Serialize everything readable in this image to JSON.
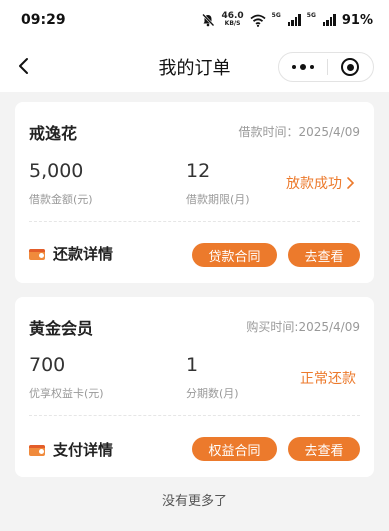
{
  "status_bar": {
    "time": "09:29",
    "net_speed": "46.0",
    "net_unit": "KB/S",
    "sig1_label": "5G",
    "sig2_label": "5G",
    "battery": "91%"
  },
  "nav": {
    "title": "我的订单"
  },
  "orders": [
    {
      "product": "戒逸花",
      "date": "借款时间：2025/4/09",
      "amount": "5,000",
      "amount_label": "借款金额(元)",
      "term": "12",
      "term_label": "借款期限(月)",
      "status": "放款成功",
      "detail": "还款详情",
      "contract_button": "贷款合同",
      "view_button": "去查看"
    },
    {
      "product": "黄金会员",
      "date": "购买时间:2025/4/09",
      "amount": "700",
      "amount_label": "优享权益卡(元)",
      "term": "1",
      "term_label": "分期数(月)",
      "status": "正常还款",
      "detail": "支付详情",
      "contract_button": "权益合同",
      "view_button": "去查看"
    }
  ],
  "footer": "没有更多了",
  "colors": {
    "accent": "#ec7a2c",
    "background": "#f3f3f3"
  },
  "icons": [
    "back-arrow-icon",
    "more-dots-icon",
    "close-target-icon",
    "chevron-right-icon",
    "wallet-icon"
  ]
}
